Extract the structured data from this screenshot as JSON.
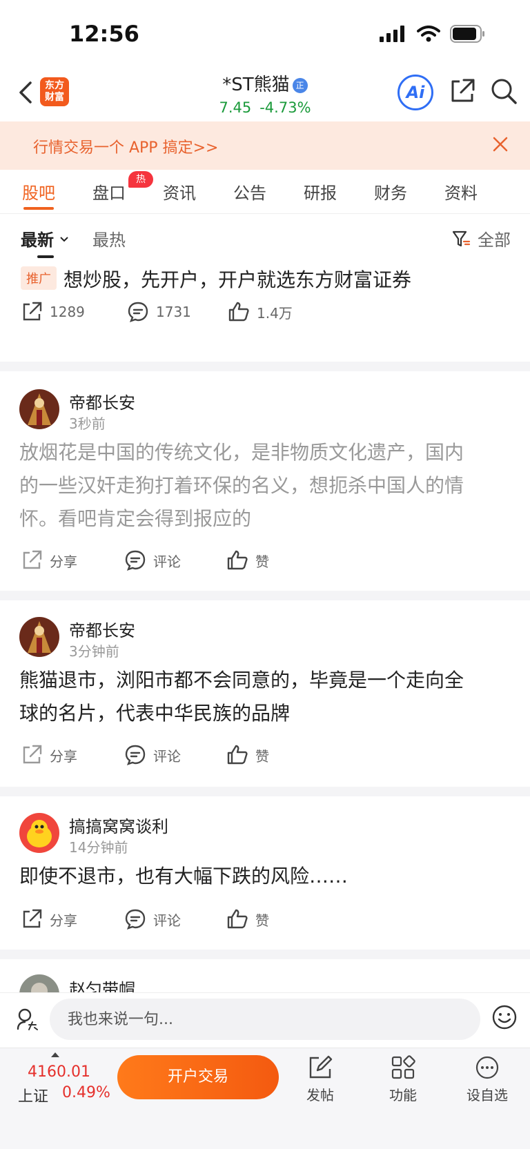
{
  "status_bar": {
    "time": "12:56"
  },
  "header": {
    "logo_text_line1": "东方",
    "logo_text_line2": "财富",
    "stock_name": "*ST熊猫",
    "badge": "正",
    "price": "7.45",
    "change_pct": "-4.73%",
    "ai_label": "Ai"
  },
  "promo_banner": {
    "text": "行情交易一个 APP 搞定>>"
  },
  "tabs": [
    {
      "label": "股吧",
      "active": true
    },
    {
      "label": "盘口",
      "badge": "热"
    },
    {
      "label": "资讯"
    },
    {
      "label": "公告"
    },
    {
      "label": "研报"
    },
    {
      "label": "财务"
    },
    {
      "label": "资料"
    }
  ],
  "sort": {
    "latest": "最新",
    "hottest": "最热",
    "filter": "全部"
  },
  "promo_post": {
    "tag": "推广",
    "title": "想炒股，先开户，开户就选东方财富证券",
    "share_count": "1289",
    "comment_count": "1731",
    "like_count": "1.4万"
  },
  "posts": [
    {
      "author": "帝都长安",
      "time": "3秒前",
      "line1": "放烟花是中国的传统文化，是非物质文化遗产，国内",
      "line2": "的一些汉奸走狗打着环保的名义，想扼杀中国人的情",
      "line3": "怀。看吧肯定会得到报应的",
      "share": "分享",
      "comment": "评论",
      "like": "赞"
    },
    {
      "author": "帝都长安",
      "time": "3分钟前",
      "line1": "熊猫退市，浏阳市都不会同意的，毕竟是一个走向全",
      "line2": "球的名片，代表中华民族的品牌",
      "share": "分享",
      "comment": "评论",
      "like": "赞"
    },
    {
      "author": "搞搞窝窝谈利",
      "time": "14分钟前",
      "line1": "即使不退市，也有大幅下跌的风险……",
      "share": "分享",
      "comment": "评论",
      "like": "赞"
    },
    {
      "author": "赵匀带帽"
    }
  ],
  "input_bar": {
    "placeholder": "我也来说一句..."
  },
  "bottom_bar": {
    "index_value": "4160.01",
    "index_name": "上证",
    "index_change": "0.49%",
    "trade_button": "开户交易",
    "post_label": "发帖",
    "function_label": "功能",
    "watchlist_label": "设自选"
  },
  "colors": {
    "accent": "#f0621f",
    "down_green": "#1a9a3a",
    "up_red": "#e5302c",
    "ai_blue": "#2f6ef5"
  }
}
